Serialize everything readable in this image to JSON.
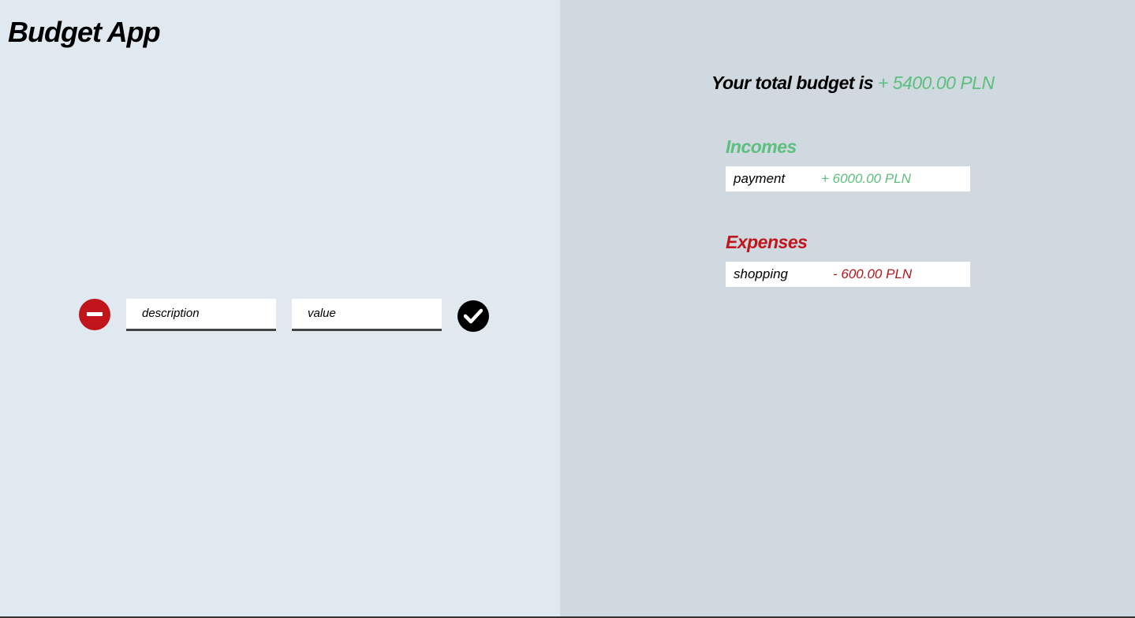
{
  "app": {
    "title": "Budget App"
  },
  "form": {
    "remove_icon": "minus-circle-icon",
    "description_placeholder": "description",
    "value_placeholder": "value",
    "submit_icon": "check-circle-icon"
  },
  "summary": {
    "label": "Your total budget is",
    "amount": "+ 5400.00 PLN"
  },
  "incomes": {
    "title": "Incomes",
    "items": [
      {
        "description": "payment",
        "amount": "+ 6000.00 PLN"
      }
    ]
  },
  "expenses": {
    "title": "Expenses",
    "items": [
      {
        "description": "shopping",
        "amount": "- 600.00 PLN"
      }
    ]
  },
  "colors": {
    "income": "#5cbf7d",
    "expense": "#c0161b",
    "left_bg": "#e1e9f0",
    "right_bg": "#d0d8e0"
  }
}
